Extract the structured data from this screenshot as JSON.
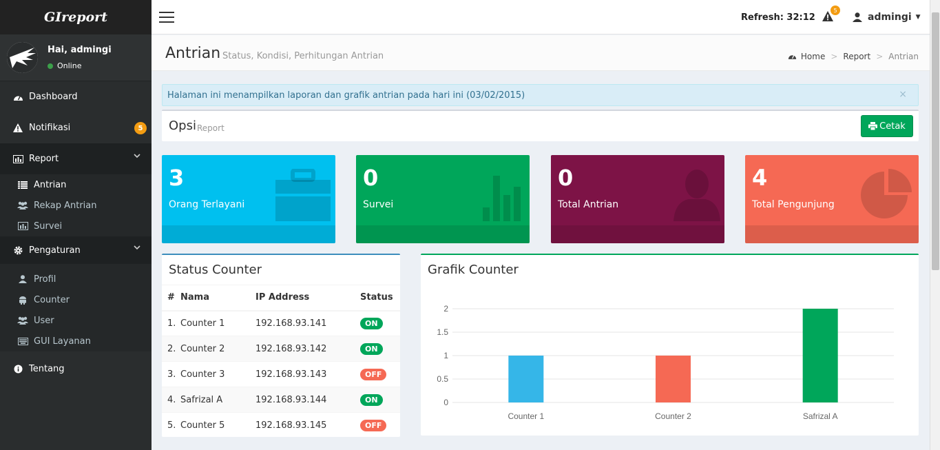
{
  "app": {
    "brand": "GIreport"
  },
  "user": {
    "greeting": "Hai, admingi",
    "status": "Online",
    "name": "admingi"
  },
  "header": {
    "refresh_label": "Refresh: 32:12",
    "alert_count": "5"
  },
  "sidebar": {
    "dashboard": "Dashboard",
    "notifikasi": "Notifikasi",
    "notifikasi_badge": "5",
    "report": "Report",
    "report_items": [
      "Antrian",
      "Rekap Antrian",
      "Survei"
    ],
    "pengaturan": "Pengaturan",
    "pengaturan_items": [
      "Profil",
      "Counter",
      "User",
      "GUI Layanan"
    ],
    "tentang": "Tentang"
  },
  "page": {
    "title": "Antrian",
    "subtitle": "Status, Kondisi, Perhitungan Antrian",
    "breadcrumb": [
      "Home",
      "Report",
      "Antrian"
    ]
  },
  "callout": {
    "text": "Halaman ini menampilkan laporan dan grafik antrian pada hari ini (03/02/2015)",
    "close": "×"
  },
  "opsi": {
    "title": "Opsi",
    "subtitle": "Report",
    "cetak_label": "Cetak"
  },
  "stats": [
    {
      "value": "3",
      "label": "Orang Terlayani",
      "color": "#00c0ef",
      "icon": "briefcase-icon"
    },
    {
      "value": "0",
      "label": "Survei",
      "color": "#00a65a",
      "icon": "bar-chart-icon"
    },
    {
      "value": "0",
      "label": "Total Antrian",
      "color": "#7d1346",
      "icon": "person-icon"
    },
    {
      "value": "4",
      "label": "Total Pengunjung",
      "color": "#f56954",
      "icon": "pie-chart-icon"
    }
  ],
  "status_counter": {
    "title": "Status Counter",
    "headers": [
      "#",
      "Nama",
      "IP Address",
      "Status"
    ],
    "rows": [
      {
        "no": "1.",
        "nama": "Counter 1",
        "ip": "192.168.93.141",
        "status": "ON"
      },
      {
        "no": "2.",
        "nama": "Counter 2",
        "ip": "192.168.93.142",
        "status": "ON"
      },
      {
        "no": "3.",
        "nama": "Counter 3",
        "ip": "192.168.93.143",
        "status": "OFF"
      },
      {
        "no": "4.",
        "nama": "Safrizal A",
        "ip": "192.168.93.144",
        "status": "ON"
      },
      {
        "no": "5.",
        "nama": "Counter 5",
        "ip": "192.168.93.145",
        "status": "OFF"
      }
    ]
  },
  "grafik": {
    "title": "Grafik Counter"
  },
  "chart_data": {
    "type": "bar",
    "categories": [
      "Counter 1",
      "Counter 2",
      "Safrizal A"
    ],
    "values": [
      1,
      1,
      2
    ],
    "colors": [
      "#35b6e8",
      "#f56954",
      "#00a65a"
    ],
    "yticks": [
      "0",
      "0.5",
      "1",
      "1.5",
      "2"
    ],
    "ylim": [
      0,
      2
    ],
    "grid": true,
    "title": "",
    "xlabel": "",
    "ylabel": ""
  }
}
